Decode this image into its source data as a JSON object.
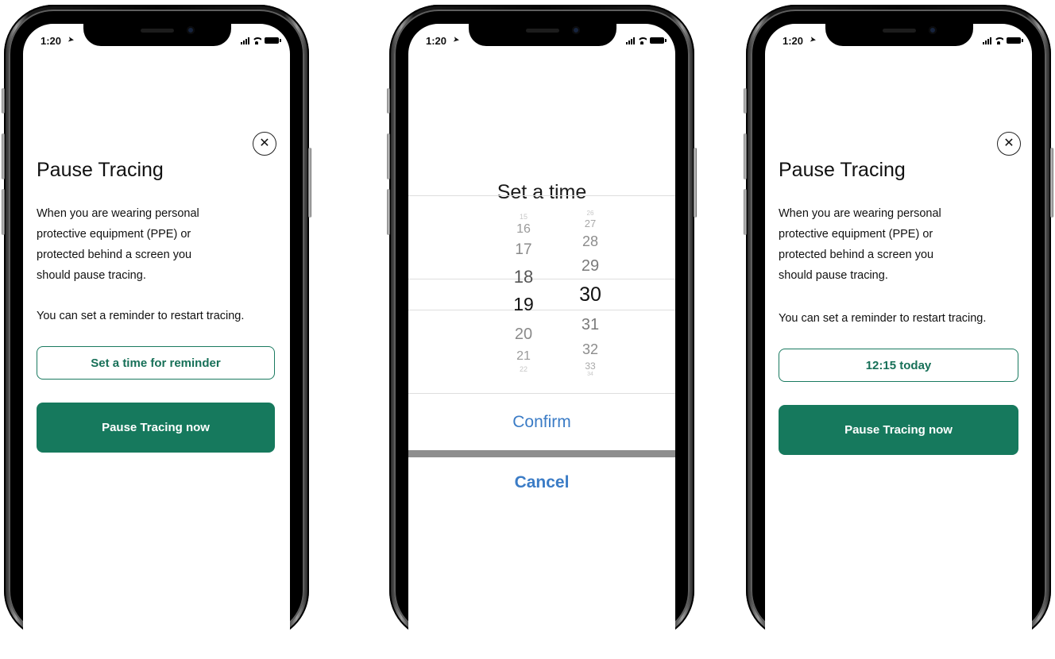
{
  "status_bar": {
    "time": "1:20"
  },
  "pause_screen": {
    "title": "Pause Tracing",
    "body_lines": [
      "When you are wearing personal",
      "protective equipment (PPE) or",
      "protected behind a screen you",
      "should pause tracing."
    ],
    "reminder_text": "You can set a reminder to restart tracing.",
    "set_time_label": "Set a time for reminder",
    "selected_time_label": "12:15 today",
    "pause_now_label": "Pause Tracing now"
  },
  "picker_screen": {
    "title": "Set a time",
    "hours": [
      "15",
      "16",
      "17",
      "18",
      "19",
      "20",
      "21",
      "22"
    ],
    "minutes": [
      "26",
      "27",
      "28",
      "29",
      "30",
      "31",
      "32",
      "33",
      "34"
    ],
    "selected_hour": "19",
    "selected_minute": "30",
    "confirm_label": "Confirm",
    "cancel_label": "Cancel"
  },
  "colors": {
    "primary_green": "#16795d",
    "ios_blue": "#3b7cc6"
  },
  "icons": {
    "close": "close-icon",
    "location": "location-arrow-icon",
    "signal": "signal-icon",
    "wifi": "wifi-icon",
    "battery": "battery-icon"
  }
}
